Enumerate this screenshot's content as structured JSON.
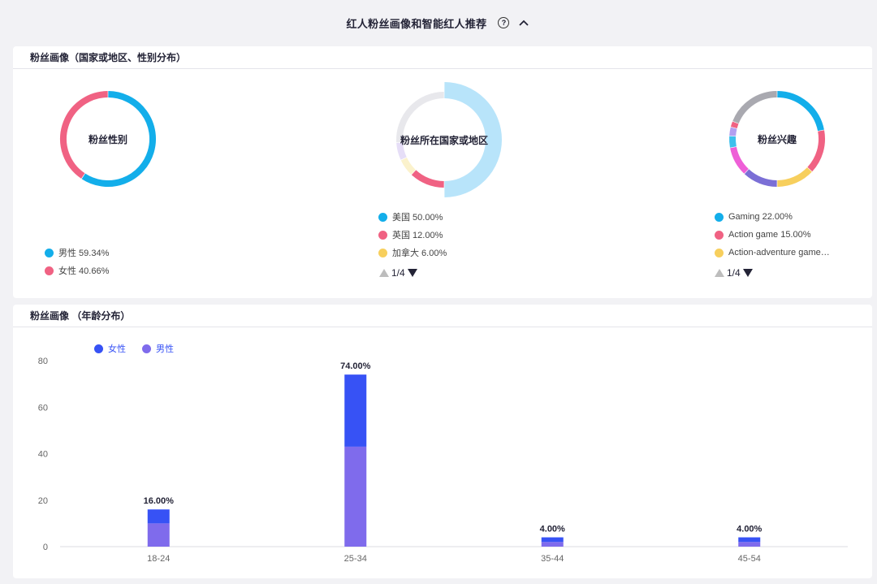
{
  "header": {
    "title": "红人粉丝画像和智能红人推荐",
    "help_icon": "?"
  },
  "geo_card": {
    "title": "粉丝画像（国家或地区、性别分布）",
    "gender": {
      "label": "粉丝性别",
      "legend": [
        {
          "text": "男性 59.34%",
          "color": "#13aeea"
        },
        {
          "text": "女性 40.66%",
          "color": "#f06283"
        }
      ],
      "segments": [
        {
          "value": 59.34,
          "color": "#13aeea"
        },
        {
          "value": 40.66,
          "color": "#f06283"
        }
      ]
    },
    "country": {
      "label": "粉丝所在国家或地区",
      "legend": [
        {
          "text": "美国 50.00%",
          "color": "#13aeea"
        },
        {
          "text": "英国 12.00%",
          "color": "#f06283"
        },
        {
          "text": "加拿大 6.00%",
          "color": "#f7cf5d"
        }
      ],
      "segments": [
        {
          "value": 50,
          "color": "#b8e4fa",
          "highlight": true
        },
        {
          "value": 12,
          "color": "#f06283"
        },
        {
          "value": 6,
          "color": "#fbf2cc"
        },
        {
          "value": 6,
          "color": "#e6def7"
        },
        {
          "value": 26,
          "color": "#e8e8ec"
        }
      ],
      "pager": "1/4"
    },
    "interest": {
      "label": "粉丝兴趣",
      "legend": [
        {
          "text": "Gaming 22.00%",
          "color": "#13aeea"
        },
        {
          "text": "Action game 15.00%",
          "color": "#f06283"
        },
        {
          "text": "Action-adventure game…",
          "color": "#f7cf5d"
        }
      ],
      "segments": [
        {
          "value": 22,
          "color": "#13aeea"
        },
        {
          "value": 15,
          "color": "#f06283"
        },
        {
          "value": 13,
          "color": "#f7cf5d"
        },
        {
          "value": 12,
          "color": "#7b6fd6"
        },
        {
          "value": 10,
          "color": "#ee5fd7"
        },
        {
          "value": 4,
          "color": "#3ec0ec"
        },
        {
          "value": 3,
          "color": "#b39ff0"
        },
        {
          "value": 2,
          "color": "#f06283"
        },
        {
          "value": 19,
          "color": "#a9a9b0"
        }
      ],
      "pager": "1/4"
    }
  },
  "age_card": {
    "title": "粉丝画像 （年龄分布）"
  },
  "chart_data": {
    "type": "bar",
    "stacked": true,
    "categories": [
      "18-24",
      "25-34",
      "35-44",
      "45-54"
    ],
    "series": [
      {
        "name": "女性",
        "color": "#3752f5",
        "values": [
          6,
          31,
          2,
          2
        ]
      },
      {
        "name": "男性",
        "color": "#7f6bec",
        "values": [
          10,
          43,
          2,
          2
        ]
      }
    ],
    "totals": [
      "16.00%",
      "74.00%",
      "4.00%",
      "4.00%"
    ],
    "ylim": [
      0,
      80
    ],
    "yticks": [
      0,
      20,
      40,
      60,
      80
    ],
    "legend_position": "top-left",
    "grid": false
  }
}
